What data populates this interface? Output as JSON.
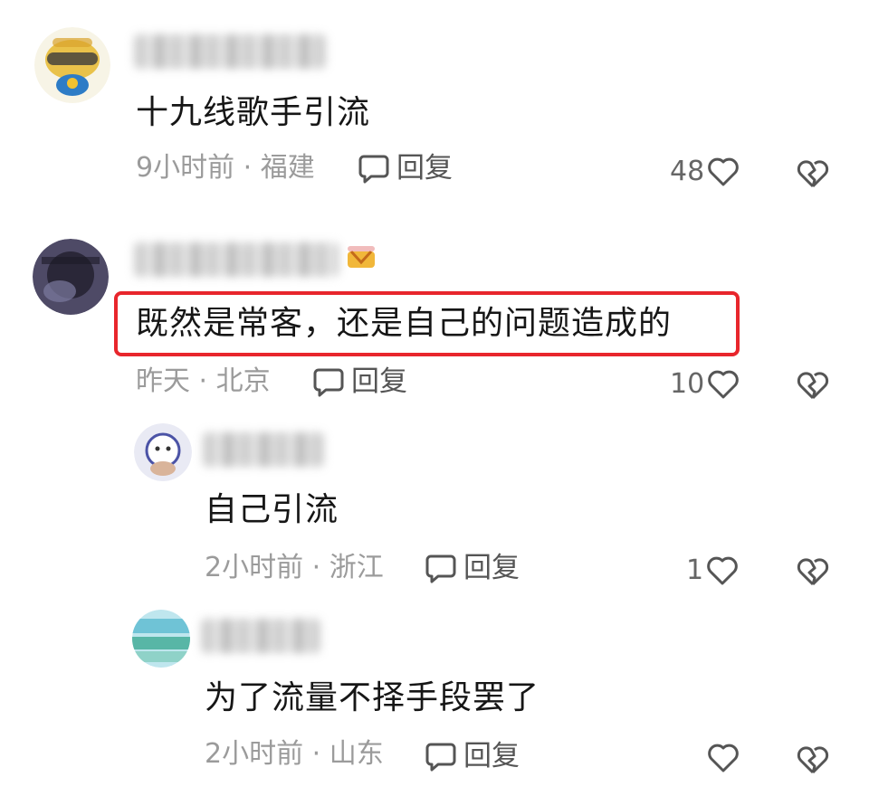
{
  "comments": [
    {
      "text": "十九线歌手引流",
      "time_location": "9小时前 · 福建",
      "reply_label": "回复",
      "likes": "48"
    },
    {
      "text": "既然是常客，还是自己的问题造成的",
      "time_location": "昨天 · 北京",
      "reply_label": "回复",
      "likes": "10",
      "highlighted": true,
      "highlight_color": "#e8262c"
    },
    {
      "text": "自己引流",
      "time_location": "2小时前 · 浙江",
      "reply_label": "回复",
      "likes": "1"
    },
    {
      "text": "为了流量不择手段罢了",
      "time_location": "2小时前 · 山东",
      "reply_label": "回复",
      "likes": ""
    }
  ],
  "icons": {
    "reply": "comment-bubble-icon",
    "like": "heart-outline-icon",
    "dislike": "broken-heart-icon"
  },
  "colors": {
    "meta_text": "#9b9b9b",
    "icon_stroke": "#555555",
    "highlight": "#e8262c"
  }
}
